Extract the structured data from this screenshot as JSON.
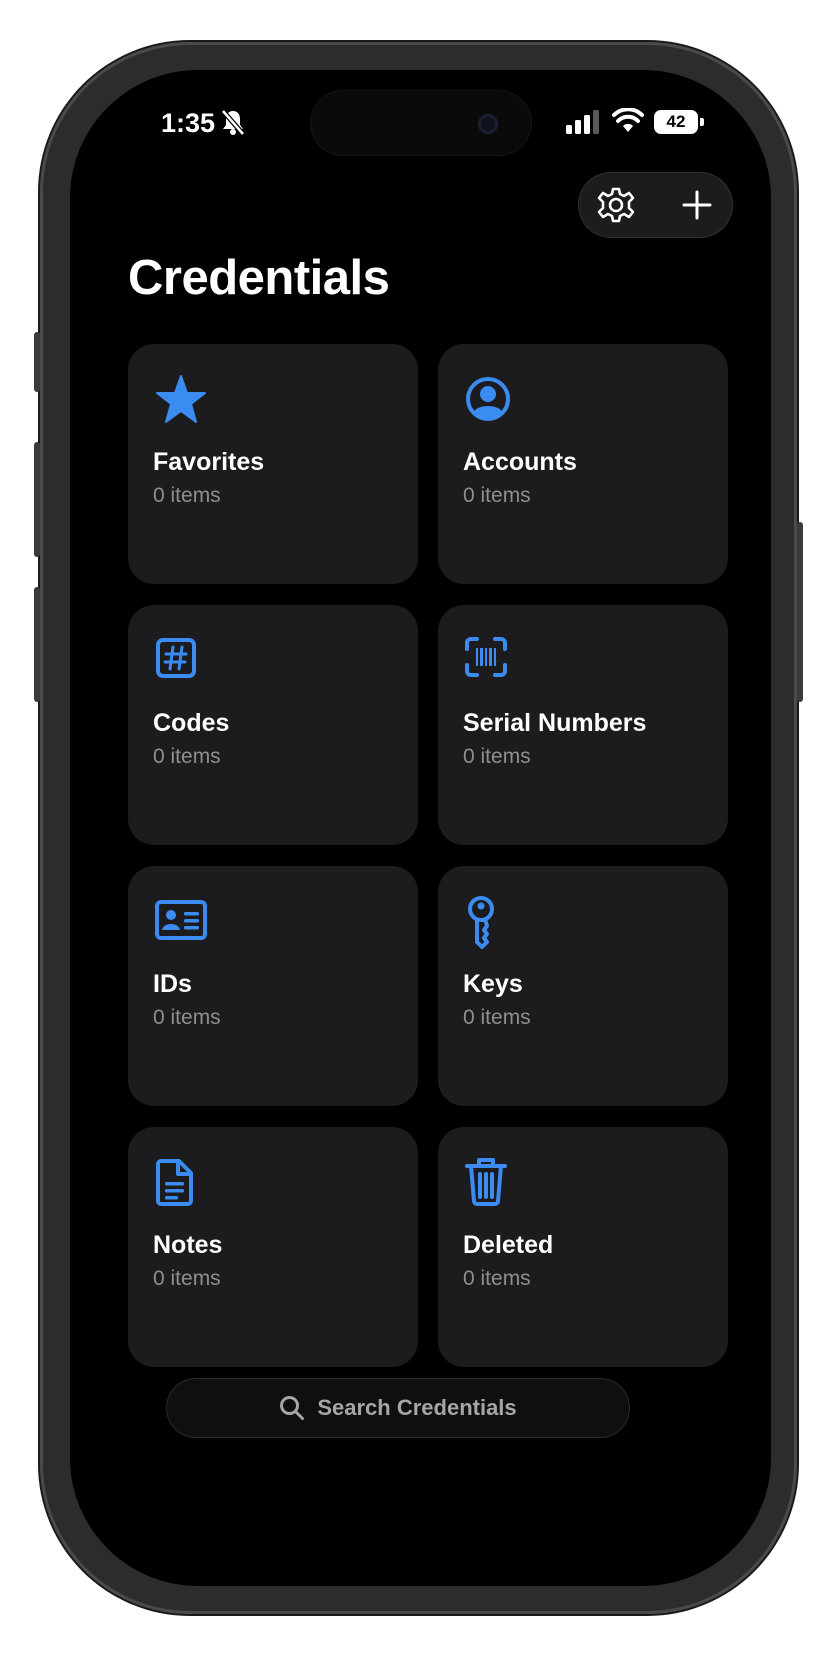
{
  "status_bar": {
    "time": "1:35",
    "battery": "42"
  },
  "toolbar": {
    "settings_icon": "gear-icon",
    "add_icon": "plus-icon"
  },
  "page": {
    "title": "Credentials"
  },
  "accent_color": "#3b8cf0",
  "categories": [
    {
      "label": "Favorites",
      "count": "0 items",
      "icon": "star-icon"
    },
    {
      "label": "Accounts",
      "count": "0 items",
      "icon": "person-circle-icon"
    },
    {
      "label": "Codes",
      "count": "0 items",
      "icon": "number-square-icon"
    },
    {
      "label": "Serial Numbers",
      "count": "0 items",
      "icon": "barcode-scan-icon"
    },
    {
      "label": "IDs",
      "count": "0 items",
      "icon": "id-card-icon"
    },
    {
      "label": "Keys",
      "count": "0 items",
      "icon": "key-icon"
    },
    {
      "label": "Notes",
      "count": "0 items",
      "icon": "document-icon"
    },
    {
      "label": "Deleted",
      "count": "0 items",
      "icon": "trash-icon"
    }
  ],
  "search": {
    "placeholder": "Search Credentials"
  }
}
